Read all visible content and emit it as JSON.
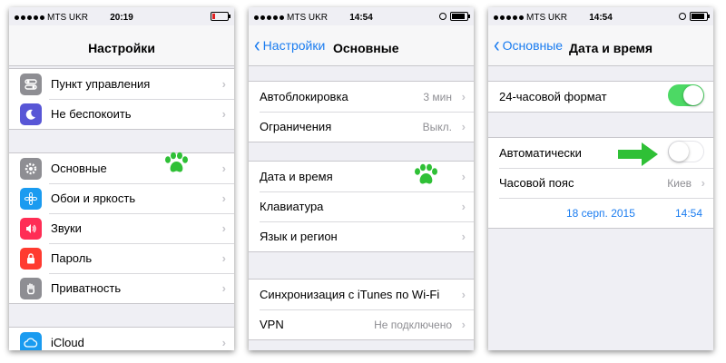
{
  "status": {
    "carrier": "MTS UKR",
    "phone1_time": "20:19",
    "phone2_time": "14:54",
    "phone3_time": "14:54"
  },
  "phone1": {
    "title": "Настройки",
    "items": [
      {
        "label": "Пункт управления",
        "icon": "toggles-icon",
        "color": "#8e8e93"
      },
      {
        "label": "Не беспокоить",
        "icon": "moon-icon",
        "color": "#5856d6"
      },
      {
        "label": "Основные",
        "icon": "gear-icon",
        "color": "#8e8e93"
      },
      {
        "label": "Обои и яркость",
        "icon": "flower-icon",
        "color": "#1a9bf0"
      },
      {
        "label": "Звуки",
        "icon": "speaker-icon",
        "color": "#ff2d55"
      },
      {
        "label": "Пароль",
        "icon": "lock-icon",
        "color": "#ff3b30"
      },
      {
        "label": "Приватность",
        "icon": "hand-icon",
        "color": "#8e8e93"
      },
      {
        "label": "iCloud",
        "icon": "cloud-icon",
        "color": "#1a9bf0"
      }
    ]
  },
  "phone2": {
    "back": "Настройки",
    "title": "Основные",
    "rows": [
      {
        "label": "Автоблокировка",
        "value": "3 мин"
      },
      {
        "label": "Ограничения",
        "value": "Выкл."
      },
      {
        "label": "Дата и время",
        "value": ""
      },
      {
        "label": "Клавиатура",
        "value": ""
      },
      {
        "label": "Язык и регион",
        "value": ""
      },
      {
        "label": "Синхронизация с iTunes по Wi-Fi",
        "value": ""
      },
      {
        "label": "VPN",
        "value": "Не подключено"
      }
    ]
  },
  "phone3": {
    "back": "Основные",
    "title": "Дата и время",
    "format24_label": "24-часовой формат",
    "format24_on": true,
    "auto_label": "Автоматически",
    "auto_on": false,
    "timezone_label": "Часовой пояс",
    "timezone_value": "Киев",
    "date": "18 серп. 2015",
    "time": "14:54"
  },
  "colors": {
    "accent": "#1a7cf0",
    "toggle_on": "#4cd964",
    "marker": "#2fc036"
  }
}
